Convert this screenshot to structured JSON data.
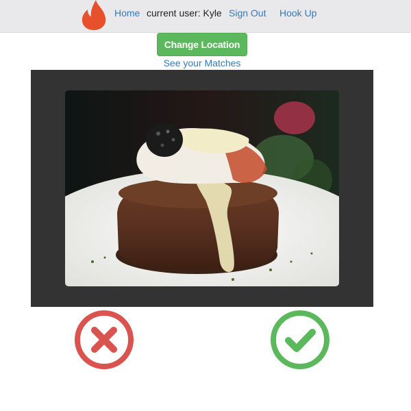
{
  "navbar": {
    "logo_icon": "flame-icon",
    "home_label": "Home",
    "current_user_text": "current user: Kyle",
    "sign_out_label": "Sign Out",
    "hook_up_label": "Hook Up"
  },
  "actions": {
    "change_location_label": "Change Location",
    "see_matches_label": "See your Matches"
  },
  "card": {
    "photo_subject": "steak-with-lobster-and-caviar"
  },
  "swipe": {
    "reject_icon": "x-icon",
    "accept_icon": "checkmark-icon"
  },
  "colors": {
    "navbar_bg": "#e9e9eb",
    "link": "#337ab7",
    "primary_green": "#5cb85c",
    "reject_red": "#d9534f",
    "flame_orange": "#e8502b",
    "card_bg": "#333333"
  }
}
